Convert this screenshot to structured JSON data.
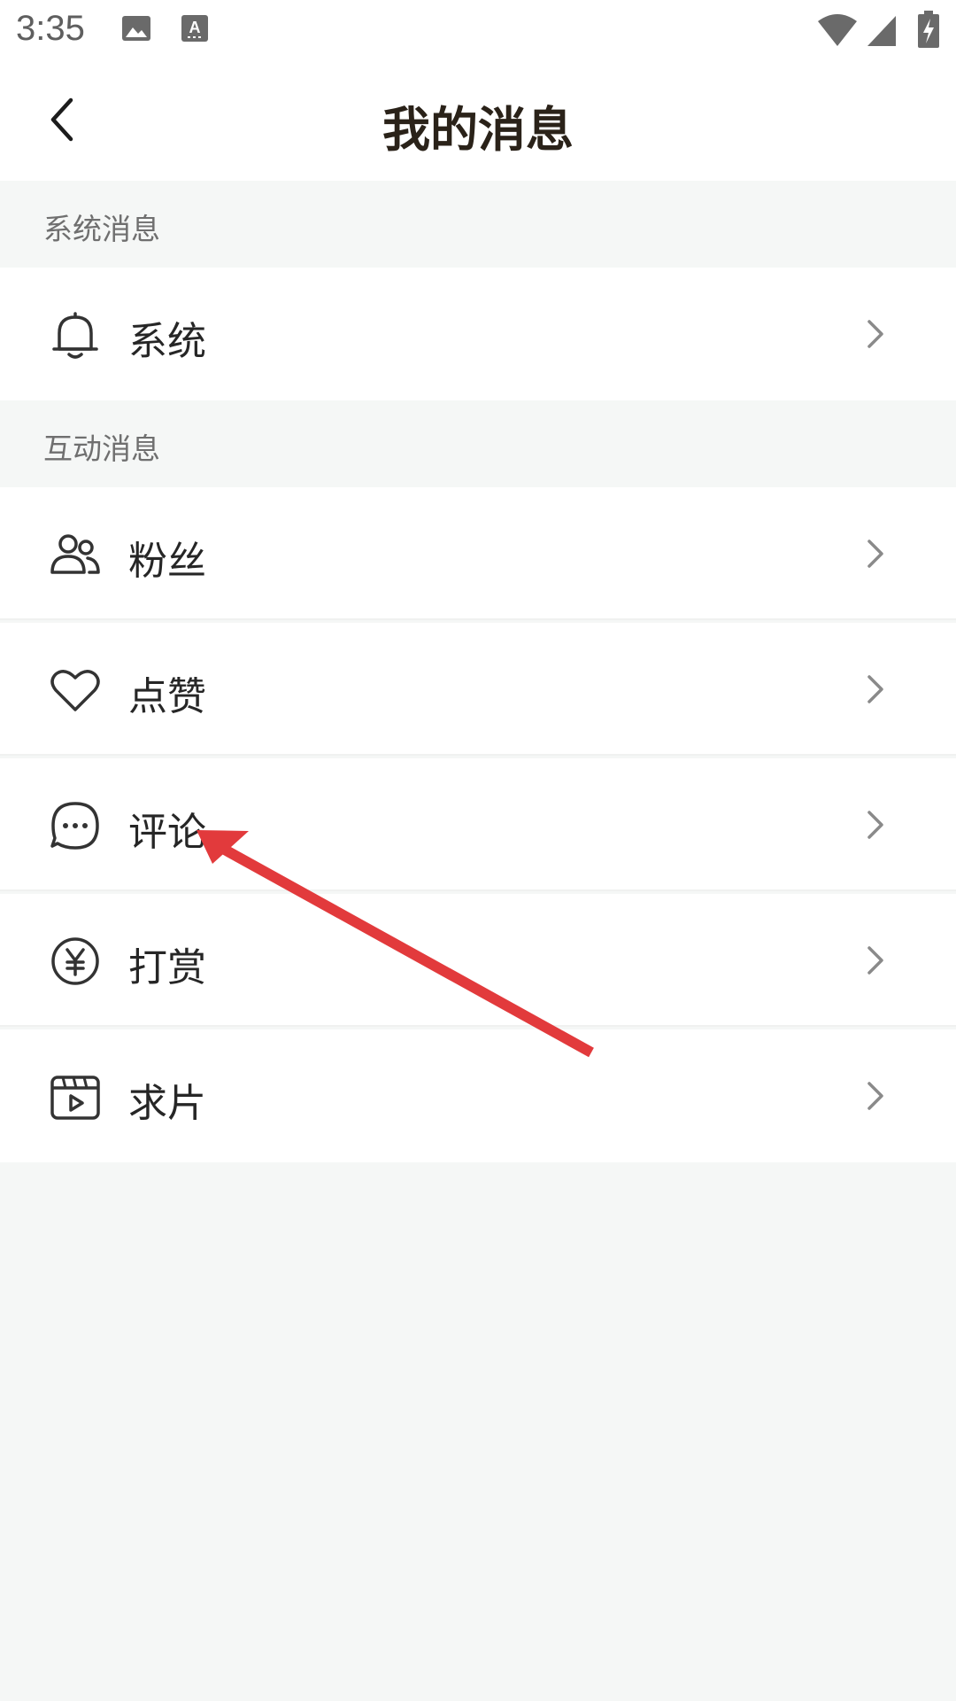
{
  "status_bar": {
    "time": "3:35",
    "icons": [
      "image-icon",
      "keyboard-icon",
      "wifi-icon",
      "signal-icon",
      "battery-charging-icon"
    ]
  },
  "header": {
    "title": "我的消息",
    "back_icon": "chevron-left-icon"
  },
  "sections": [
    {
      "label": "系统消息",
      "items": [
        {
          "label": "系统",
          "icon": "bell-icon"
        }
      ]
    },
    {
      "label": "互动消息",
      "items": [
        {
          "label": "粉丝",
          "icon": "users-icon"
        },
        {
          "label": "点赞",
          "icon": "heart-icon"
        },
        {
          "label": "评论",
          "icon": "comment-icon"
        },
        {
          "label": "打赏",
          "icon": "yuan-coin-icon"
        },
        {
          "label": "求片",
          "icon": "video-icon"
        }
      ]
    }
  ],
  "colors": {
    "background": "#f5f7f6",
    "row_background": "#ffffff",
    "title": "#2a2219",
    "section_label": "#6f6f6f",
    "annotation_arrow": "#e23a3c"
  }
}
